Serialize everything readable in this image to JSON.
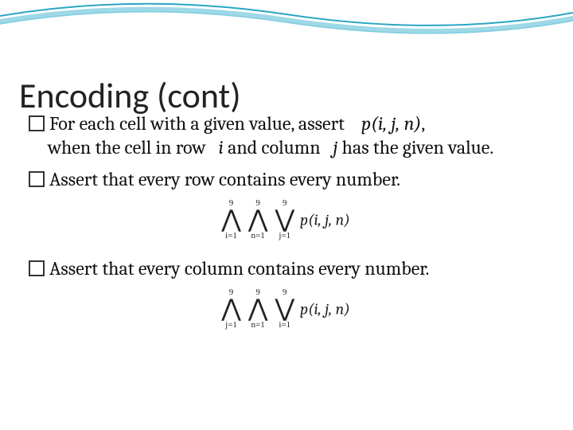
{
  "title": "Encoding (cont)",
  "bullets": [
    {
      "part1": "For each cell with a given value, assert",
      "math1": "p(i, j, n)",
      "part2": ",",
      "part3": "when the cell in row",
      "math2": "i",
      "part4": "and column",
      "math3": "j",
      "part5": "has the given value."
    },
    {
      "text": "Assert that every row contains every number."
    },
    {
      "text": "Assert that every column contains every number."
    }
  ],
  "formula1": {
    "op1": {
      "sym": "⋀",
      "upper": "9",
      "lower": "i=1"
    },
    "op2": {
      "sym": "⋀",
      "upper": "9",
      "lower": "n=1"
    },
    "op3": {
      "sym": "⋁",
      "upper": "9",
      "lower": "j=1"
    },
    "term": "p(i, j, n)"
  },
  "formula2": {
    "op1": {
      "sym": "⋀",
      "upper": "9",
      "lower": "j=1"
    },
    "op2": {
      "sym": "⋀",
      "upper": "9",
      "lower": "n=1"
    },
    "op3": {
      "sym": "⋁",
      "upper": "9",
      "lower": "i=1"
    },
    "term": "p(i, j, n)"
  }
}
